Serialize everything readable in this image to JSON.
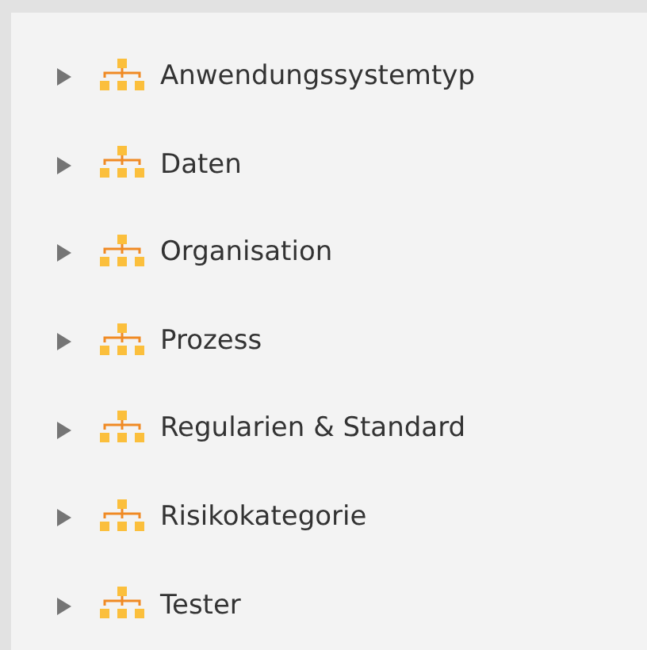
{
  "tree": {
    "items": [
      {
        "label": "Anwendungssystemtyp",
        "expanded": false
      },
      {
        "label": "Daten",
        "expanded": false
      },
      {
        "label": "Organisation",
        "expanded": false
      },
      {
        "label": "Prozess",
        "expanded": false
      },
      {
        "label": "Regularien & Standard",
        "expanded": false
      },
      {
        "label": "Risikokategorie",
        "expanded": false
      },
      {
        "label": "Tester",
        "expanded": false
      }
    ]
  }
}
